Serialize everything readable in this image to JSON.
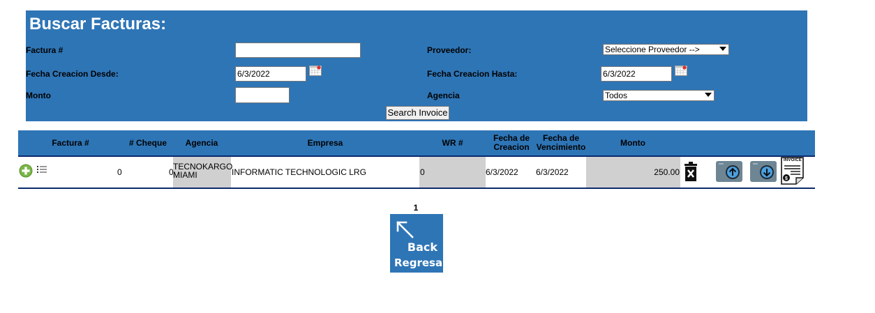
{
  "search": {
    "title": "Buscar Facturas:",
    "factura_label": "Factura #",
    "factura_value": "",
    "proveedor_label": "Proveedor:",
    "proveedor_selected": "Seleccione Proveedor -->",
    "fecha_desde_label": "Fecha Creacion Desde:",
    "fecha_desde_value": "6/3/2022",
    "fecha_hasta_label": "Fecha Creacion Hasta:",
    "fecha_hasta_value": "6/3/2022",
    "monto_label": "Monto",
    "monto_value": "",
    "agencia_label": "Agencia",
    "agencia_selected": "Todos",
    "search_button": "Search Invoice"
  },
  "table": {
    "headers": {
      "factura": "Factura #",
      "cheque": "# Cheque",
      "agencia": "Agencia",
      "empresa": "Empresa",
      "wr": "WR #",
      "fecha_creacion_1": "Fecha de",
      "fecha_creacion_2": "Creacion",
      "fecha_venc_1": "Fecha de",
      "fecha_venc_2": "Vencimiento",
      "monto": "Monto"
    },
    "rows": [
      {
        "factura": "0",
        "cheque": "0",
        "agencia_1": "TECNOKARGO",
        "agencia_2": "MIAMI",
        "empresa": "INFORMATIC TECHNOLOGIC LRG",
        "wr": "0",
        "fecha_creacion": "6/3/2022",
        "fecha_vencimiento": "6/3/2022",
        "monto": "250.00",
        "invoice_icon_text": "INVOICE"
      }
    ]
  },
  "pagination": {
    "current_page": "1"
  },
  "back_button": {
    "line1": "Back",
    "line2": "Regresar"
  },
  "colors": {
    "panel_blue": "#2e75b6",
    "border_navy": "#0b2a6e",
    "shade_gray": "#d0d0d0",
    "add_green": "#7ab648"
  },
  "icons": [
    "add-circle-icon",
    "list-icon",
    "calendar-icon",
    "trash-icon",
    "upload-icon",
    "download-icon",
    "invoice-icon",
    "back-arrow-icon"
  ]
}
